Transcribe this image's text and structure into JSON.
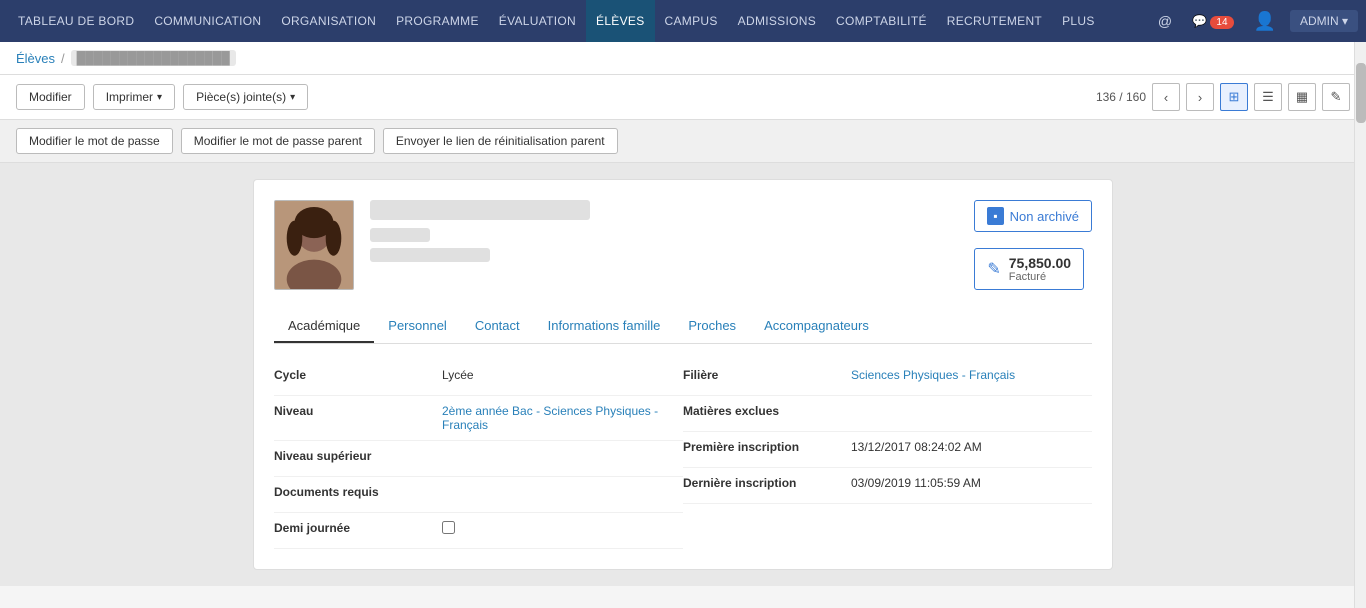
{
  "nav": {
    "items": [
      {
        "label": "TABLEAU DE BORD",
        "active": false
      },
      {
        "label": "COMMUNICATION",
        "active": false
      },
      {
        "label": "ORGANISATION",
        "active": false
      },
      {
        "label": "PROGRAMME",
        "active": false
      },
      {
        "label": "ÉVALUATION",
        "active": false
      },
      {
        "label": "ÉLÈVES",
        "active": true
      },
      {
        "label": "CAMPUS",
        "active": false
      },
      {
        "label": "ADMISSIONS",
        "active": false
      },
      {
        "label": "COMPTABILITÉ",
        "active": false
      },
      {
        "label": "RECRUTEMENT",
        "active": false
      },
      {
        "label": "PLUS",
        "active": false,
        "dropdown": true
      }
    ],
    "right": {
      "messages_count": "14",
      "admin_label": "ADMIN ▾"
    }
  },
  "breadcrumb": {
    "parent": "Élèves",
    "current": "██████████████████"
  },
  "toolbar": {
    "modifier_label": "Modifier",
    "imprimer_label": "Imprimer",
    "pieces_label": "Pièce(s) jointe(s)",
    "pager": "136 / 160",
    "icons": {
      "prev": "‹",
      "next": "›",
      "grid": "⊞",
      "list": "☰",
      "chart": "▦",
      "edit": "✎"
    }
  },
  "action_bar": {
    "btn1": "Modifier le mot de passe",
    "btn2": "Modifier le mot de passe parent",
    "btn3": "Envoyer le lien de réinitialisation parent"
  },
  "student": {
    "name_placeholder": "██████████████████████",
    "id_placeholder": "███",
    "phone_placeholder": "██████████",
    "archive_label": "Non archivé",
    "billing_amount": "75,850.00",
    "billing_label": "Facturé"
  },
  "tabs": [
    {
      "label": "Académique",
      "active": true
    },
    {
      "label": "Personnel",
      "active": false
    },
    {
      "label": "Contact",
      "active": false
    },
    {
      "label": "Informations famille",
      "active": false
    },
    {
      "label": "Proches",
      "active": false
    },
    {
      "label": "Accompagnateurs",
      "active": false
    }
  ],
  "academic": {
    "left": [
      {
        "label": "Cycle",
        "value": "Lycée",
        "link": false
      },
      {
        "label": "Niveau",
        "value": "2ème année Bac - Sciences Physiques - Français",
        "link": true
      },
      {
        "label": "Niveau supérieur",
        "value": "",
        "link": false
      },
      {
        "label": "Documents requis",
        "value": "",
        "link": false
      },
      {
        "label": "Demi journée",
        "value": "",
        "link": false
      }
    ],
    "right": [
      {
        "label": "Filière",
        "value": "Sciences Physiques - Français",
        "link": true
      },
      {
        "label": "Matières exclues",
        "value": "",
        "link": false
      },
      {
        "label": "Première inscription",
        "value": "13/12/2017 08:24:02 AM",
        "link": false
      },
      {
        "label": "Dernière inscription",
        "value": "03/09/2019 11:05:59 AM",
        "link": false
      }
    ]
  }
}
